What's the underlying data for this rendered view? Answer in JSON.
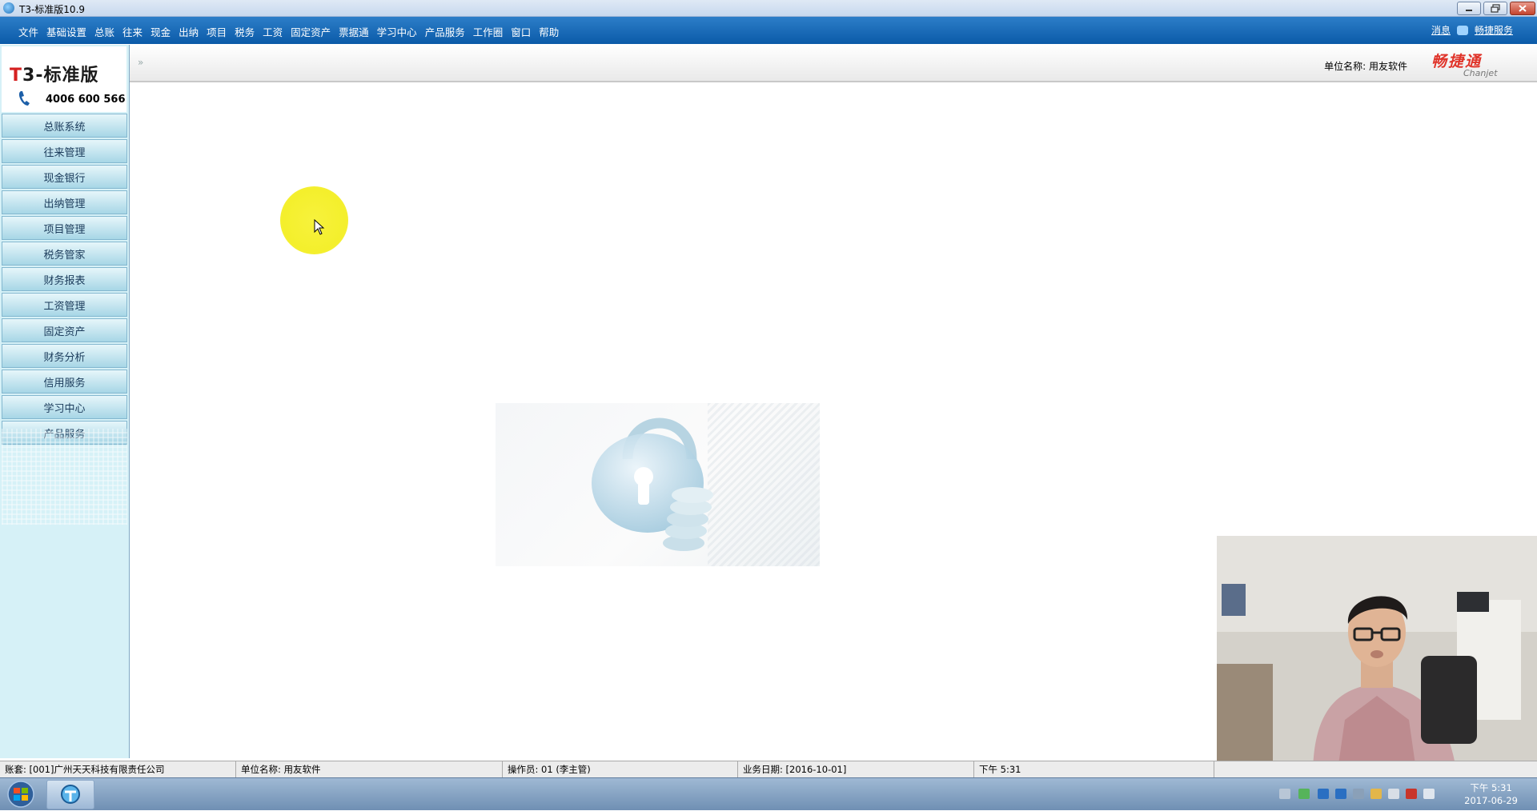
{
  "window": {
    "title": "T3-标准版10.9"
  },
  "menubar": {
    "items": [
      "文件",
      "基础设置",
      "总账",
      "往来",
      "现金",
      "出纳",
      "项目",
      "税务",
      "工资",
      "固定资产",
      "票据通",
      "学习中心",
      "产品服务",
      "工作圈",
      "窗口",
      "帮助"
    ],
    "right_links": [
      "消息",
      "畅捷服务"
    ]
  },
  "logo": {
    "brand": "T3-标准版",
    "phone": "4006 600 566"
  },
  "sidebar": {
    "items": [
      "总账系统",
      "往来管理",
      "现金银行",
      "出纳管理",
      "项目管理",
      "税务管家",
      "财务报表",
      "工资管理",
      "固定资产",
      "财务分析",
      "信用服务",
      "学习中心",
      "产品服务"
    ]
  },
  "header": {
    "chevron": "»",
    "unit_label": "单位名称: 用友软件",
    "chanjet_cn": "畅捷通",
    "chanjet_en": "Chanjet"
  },
  "statusbar": {
    "account": "账套: [001]广州天天科技有限责任公司",
    "unit": "单位名称: 用友软件",
    "operator": "操作员: 01 (李主管)",
    "business_date": "业务日期: [2016-10-01]",
    "time": "下午 5:31"
  },
  "taskbar": {
    "clock_time": "下午 5:31",
    "clock_date": "2017-06-29"
  },
  "colors": {
    "menubar": "#0b5aa8",
    "sidebar_bg": "#d6f1f7",
    "brand_red": "#d52020",
    "cursor_highlight": "#f4ef2c"
  }
}
